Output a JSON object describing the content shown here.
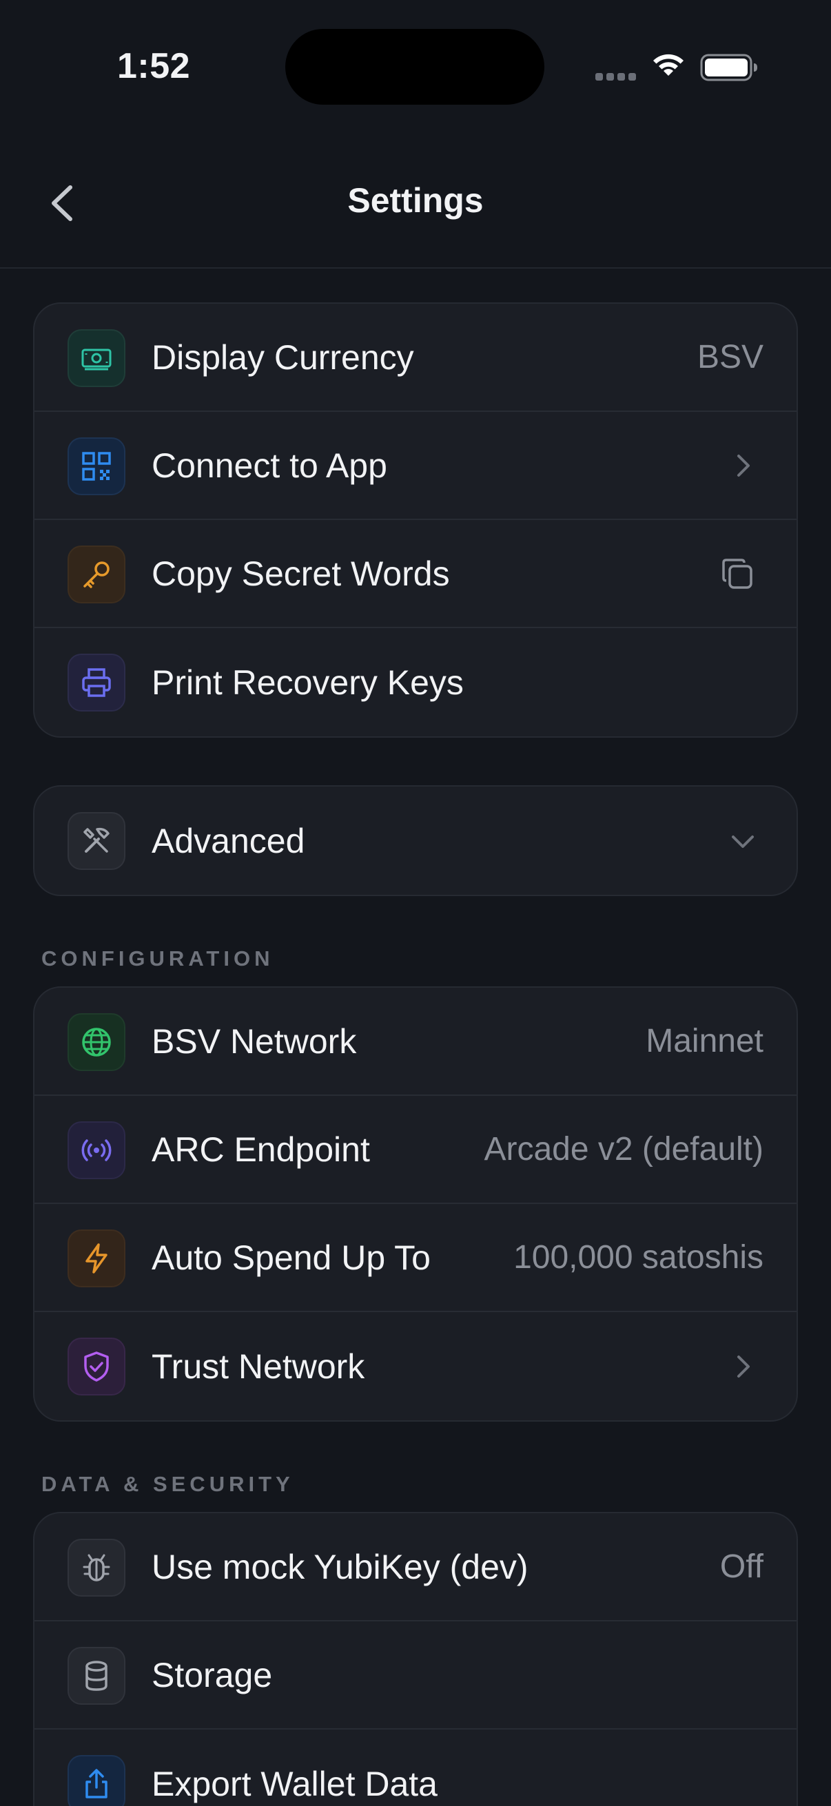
{
  "status_bar": {
    "time": "1:52"
  },
  "nav": {
    "title": "Settings",
    "back_icon": "chevron-left-icon"
  },
  "card_main": [
    {
      "label": "Display Currency",
      "value": "BSV",
      "icon": "banknote-icon",
      "accent": "#2ec4a6"
    },
    {
      "label": "Connect to App",
      "icon": "qr-code-icon",
      "accent": "#2f8cf0",
      "trail": "chevron-right-icon"
    },
    {
      "label": "Copy Secret Words",
      "icon": "key-icon",
      "accent": "#e79a2b",
      "trail": "copy-icon"
    },
    {
      "label": "Print Recovery Keys",
      "icon": "printer-icon",
      "accent": "#6b6ef0"
    }
  ],
  "advanced": {
    "label": "Advanced",
    "icon": "tools-icon",
    "trail": "chevron-down-icon"
  },
  "configuration": {
    "header": "CONFIGURATION",
    "items": [
      {
        "label": "BSV Network",
        "value": "Mainnet",
        "icon": "globe-icon",
        "accent": "#32c46c"
      },
      {
        "label": "ARC Endpoint",
        "value": "Arcade v2 (default)",
        "icon": "broadcast-icon",
        "accent": "#7a6cf0"
      },
      {
        "label": "Auto Spend Up To",
        "value": "100,000 satoshis",
        "icon": "lightning-icon",
        "accent": "#e7962b"
      },
      {
        "label": "Trust Network",
        "icon": "shield-check-icon",
        "accent": "#b35ef0",
        "trail": "chevron-right-icon"
      }
    ]
  },
  "data_security": {
    "header": "DATA & SECURITY",
    "items": [
      {
        "label": "Use mock YubiKey (dev)",
        "value": "Off",
        "icon": "bug-icon",
        "accent": "#a0a4ac"
      },
      {
        "label": "Storage",
        "icon": "database-icon",
        "accent": "#a0a4ac"
      },
      {
        "label": "Export Wallet Data",
        "icon": "share-icon",
        "accent": "#2f8cf0"
      }
    ]
  },
  "colors": {
    "background": "#13161c",
    "card": "#1b1e25",
    "muted": "#8b8f98"
  }
}
